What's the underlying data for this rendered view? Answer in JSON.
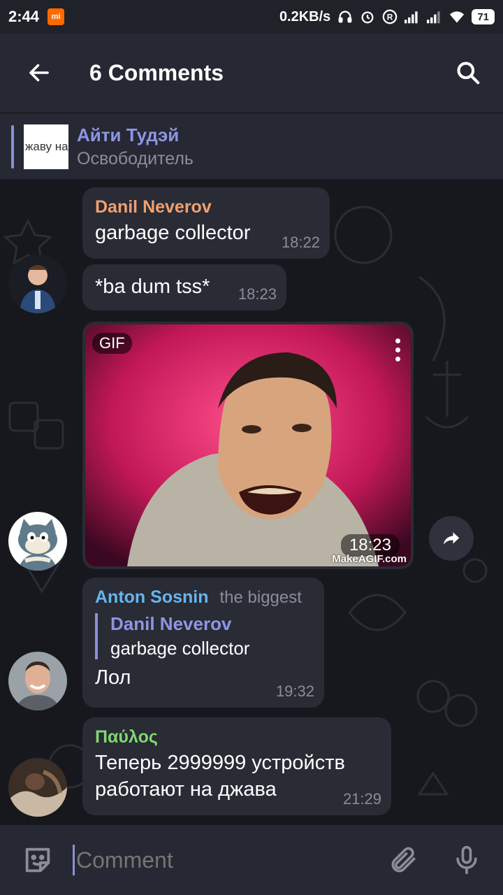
{
  "status_bar": {
    "time": "2:44",
    "speed": "0.2KB/s",
    "battery": "71",
    "notification_badge": "mi",
    "icons": [
      "headphones-icon",
      "alarm-icon",
      "registered-icon",
      "signal-icon",
      "signal-icon-2",
      "wifi-icon"
    ]
  },
  "header": {
    "title": "6 Comments",
    "back_icon": "arrow-left-icon",
    "search_icon": "search-icon"
  },
  "pinned": {
    "title": "Айти Тудэй",
    "subtitle": "Освободитель",
    "thumb_text": "жаву на"
  },
  "messages": [
    {
      "sender": "Danil Neverov",
      "sender_color": "#f0a070",
      "text": "garbage collector",
      "time": "18:22"
    },
    {
      "text": "*ba dum tss*",
      "time": "18:23"
    },
    {
      "type": "gif",
      "badge": "GIF",
      "time": "18:23",
      "watermark": "MakeAGIF.com"
    },
    {
      "sender": "Anton Sosnin",
      "sender_color": "#64b5f0",
      "sender_title": "the biggest",
      "reply_to": {
        "name": "Danil Neverov",
        "text": "garbage collector"
      },
      "text": "Лол",
      "time": "19:32"
    },
    {
      "sender": "Παύλος",
      "sender_color": "#7fd86e",
      "text_lines": [
        "Теперь 2999999 устройств",
        "работают на джава"
      ],
      "time": "21:29"
    }
  ],
  "composer": {
    "placeholder": "Comment",
    "emoji_icon": "sticker-icon",
    "attach_icon": "paperclip-icon",
    "mic_icon": "microphone-icon"
  },
  "colors": {
    "accent": "#8e95e3",
    "bubble": "#292b35",
    "background": "#17181d",
    "header": "#262833"
  }
}
